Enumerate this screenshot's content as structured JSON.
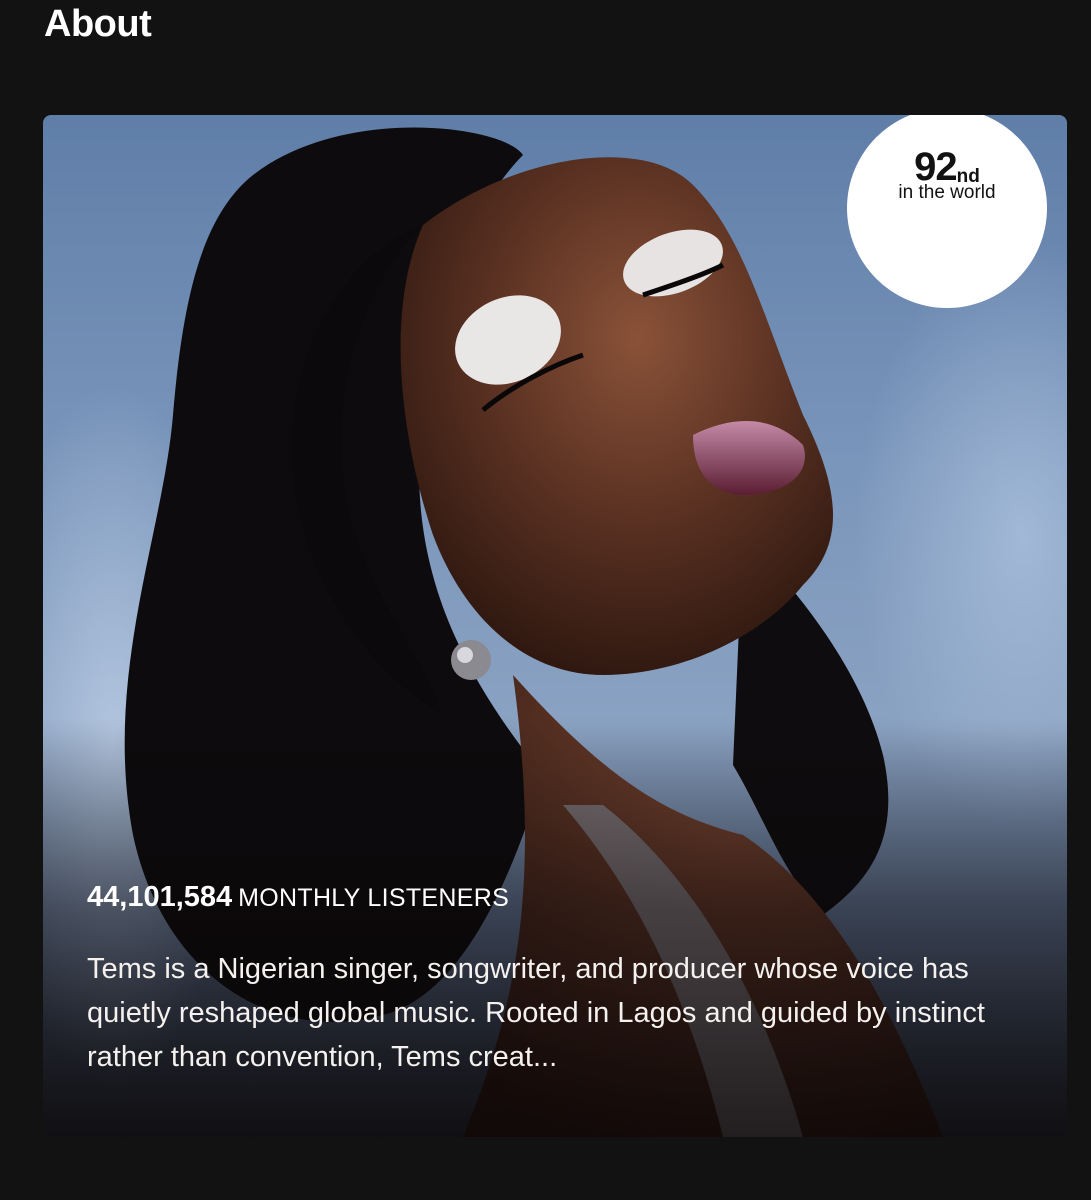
{
  "section": {
    "title": "About"
  },
  "rank": {
    "number": "92",
    "suffix": "nd",
    "label": "in the world"
  },
  "listeners": {
    "count": "44,101,584",
    "label": "MONTHLY LISTENERS"
  },
  "bio": {
    "text": "Tems is a Nigerian singer, songwriter, and producer whose voice has quietly reshaped global music. Rooted in Lagos and guided by instinct rather than convention, Tems creat..."
  },
  "image": {
    "icon": "artist-photo",
    "accent_background": "#7b96bb",
    "badge_color": "#ffffff"
  }
}
